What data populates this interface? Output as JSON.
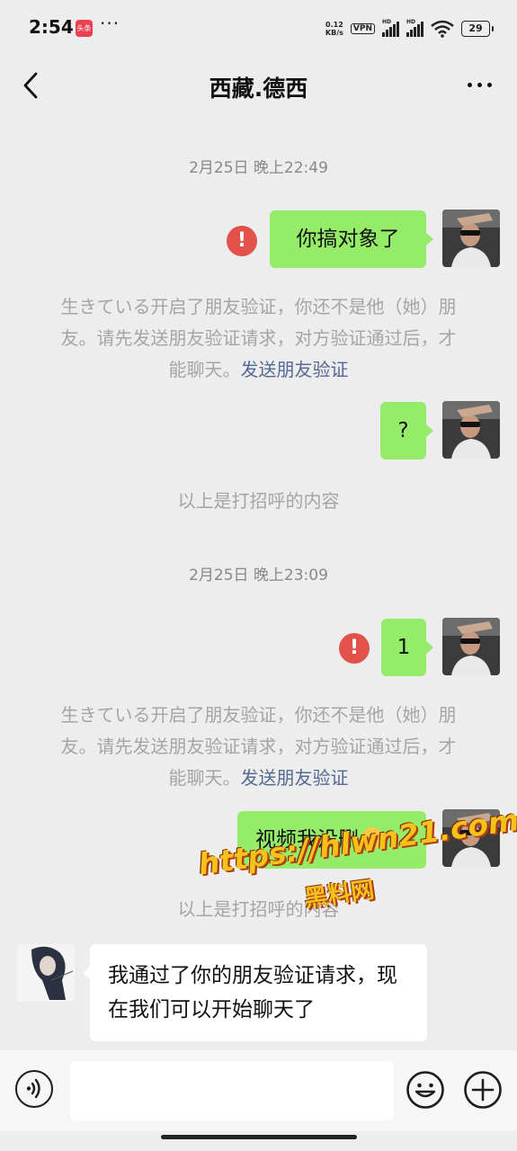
{
  "status_bar": {
    "time": "2:54",
    "app_badge": "头条",
    "more_dots": "···",
    "net_speed_value": "0.12",
    "net_speed_unit": "KB/s",
    "vpn": "VPN",
    "signal1_label": "HD",
    "signal2_label": "HD",
    "battery": "29"
  },
  "header": {
    "title": "西藏.德西"
  },
  "chat": {
    "ts1": "2月25日 晚上22:49",
    "msg1": "你搞对象了",
    "sys1_text": "生きている开启了朋友验证，你还不是他（她）朋友。请先发送朋友验证请求，对方验证通过后，才能聊天。",
    "sys1_link": "发送朋友验证",
    "msg2": "?",
    "greeting1": "以上是打招呼的内容",
    "ts2": "2月25日 晚上23:09",
    "msg3": "1",
    "sys2_text": "生きている开启了朋友验证，你还不是他（她）朋友。请先发送朋友验证请求，对方验证通过后，才能聊天。",
    "sys2_link": "发送朋友验证",
    "msg4": "视频我没删",
    "greeting2": "以上是打招呼的内容",
    "msg5": "我通过了你的朋友验证请求，现在我们可以开始聊天了"
  },
  "watermark": {
    "url": "https://hlwn21.com",
    "name": "黑料网"
  },
  "colors": {
    "sent_bubble": "#95ec69",
    "link": "#546a94",
    "warning": "#e2524a",
    "background": "#ededed"
  },
  "icons": {
    "back": "chevron-left-icon",
    "more": "more-dots-icon",
    "voice": "voice-icon",
    "emoji": "emoji-icon",
    "plus": "plus-icon",
    "warning": "exclamation-icon"
  }
}
